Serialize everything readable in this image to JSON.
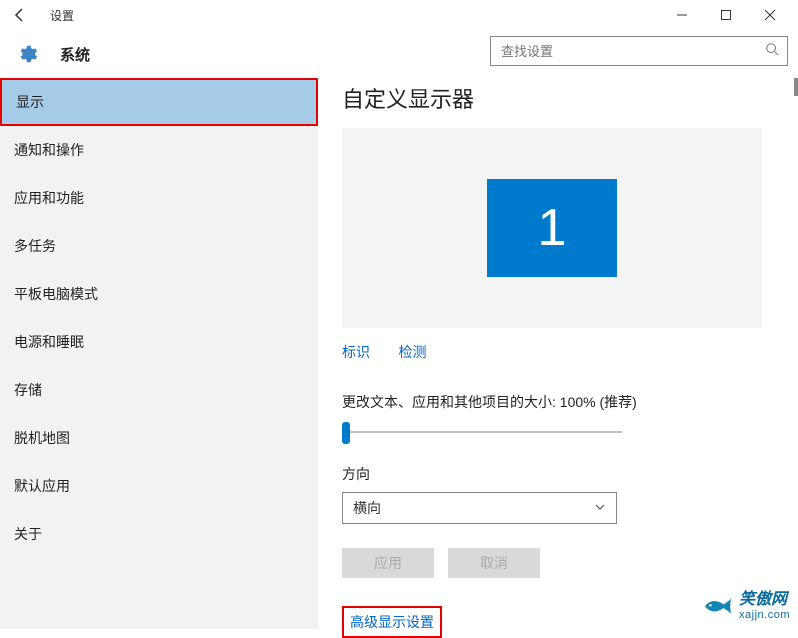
{
  "titlebar": {
    "title": "设置"
  },
  "header": {
    "title": "系统"
  },
  "search": {
    "placeholder": "查找设置"
  },
  "sidebar": {
    "items": [
      {
        "label": "显示",
        "selected": true
      },
      {
        "label": "通知和操作"
      },
      {
        "label": "应用和功能"
      },
      {
        "label": "多任务"
      },
      {
        "label": "平板电脑模式"
      },
      {
        "label": "电源和睡眠"
      },
      {
        "label": "存储"
      },
      {
        "label": "脱机地图"
      },
      {
        "label": "默认应用"
      },
      {
        "label": "关于"
      }
    ]
  },
  "main": {
    "heading": "自定义显示器",
    "monitor_number": "1",
    "link_identify": "标识",
    "link_detect": "检测",
    "scale_label": "更改文本、应用和其他项目的大小: 100% (推荐)",
    "orientation_label": "方向",
    "orientation_value": "横向",
    "apply_label": "应用",
    "cancel_label": "取消",
    "advanced_link": "高级显示设置"
  },
  "watermark": {
    "cn": "笑傲网",
    "url": "xajjn.com"
  }
}
